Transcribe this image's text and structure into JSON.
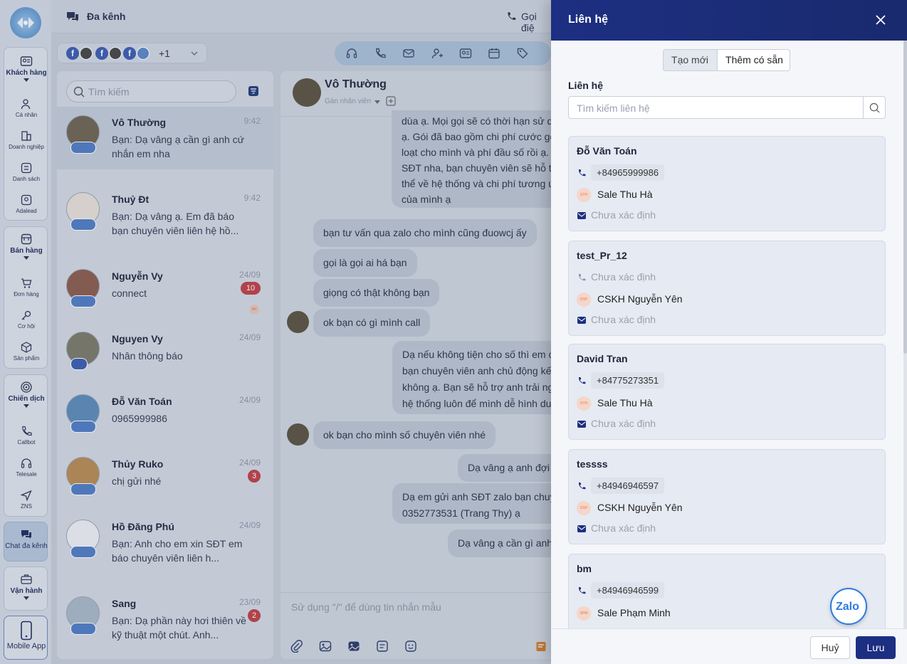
{
  "rail": {
    "khach_hang": "Khách hàng",
    "ca_nhan": "Cá nhân",
    "doanh_nghiep": "Doanh nghiệp",
    "danh_sach": "Danh sách",
    "adalead": "Adalead",
    "ban_hang": "Bán hàng",
    "don_hang": "Đơn hàng",
    "co_hoi": "Cơ hội",
    "san_pham": "Sản phẩm",
    "chien_dich": "Chiến dịch",
    "callbot": "Callbot",
    "telesale": "Telesale",
    "zns": "ZNS",
    "chat_da_kenh": "Chat đa kênh",
    "van_hanh": "Vận hành",
    "mobile_app": "Mobile App"
  },
  "header": {
    "title": "Đa kênh",
    "call": "Gọi điệ"
  },
  "channels": {
    "more": "+1"
  },
  "list": {
    "search_placeholder": "Tìm kiếm",
    "items": [
      {
        "name": "Vô Thường",
        "time": "9:42",
        "msg": "Bạn: Dạ vâng ạ cần gì anh cứ nhắn em nha"
      },
      {
        "name": "Thuỷ Đt",
        "time": "9:42",
        "msg": "Bạn: Dạ vâng ạ. Em đã báo bạn chuyên viên liên hệ hồ..."
      },
      {
        "name": "Nguyễn Vy",
        "time": "24/09",
        "msg": "connect",
        "count": "10",
        "tag": "NV"
      },
      {
        "name": "Nguyen Vy",
        "time": "24/09",
        "msg": "Nhân thông báo"
      },
      {
        "name": "Đỗ Văn Toán",
        "time": "24/09",
        "msg": "0965999986"
      },
      {
        "name": "Thủy Ruko",
        "time": "24/09",
        "msg": "chị gửi nhé",
        "count": "3"
      },
      {
        "name": "Hồ Đăng Phú",
        "time": "24/09",
        "msg": "Bạn: Anh cho em xin SĐT em báo chuyên viên liên h..."
      },
      {
        "name": "Sang",
        "time": "23/09",
        "msg": "Bạn: Dạ phần này hơi thiên về kỹ thuật một chút. Anh...",
        "count": "2"
      }
    ]
  },
  "chat": {
    "name": "Vô Thường",
    "assign": "Gán nhân viên",
    "messages": [
      {
        "text": "dùa ạ. Mọi gọi sẽ có thời hạn sử d\nạ. Gói đã bao gồm chi phí cước gọ\nloạt cho mình và phí đầu số rồi ạ.\nSĐT nha, bạn chuyên viên sẽ hỗ tr\nthể về hệ thống và chi phí tương ứ\ncủa mình ạ"
      },
      {
        "text": "bạn tư vấn qua zalo cho mình cũng đuowcj ấy"
      },
      {
        "text": "gọi là gọi ai há bạn"
      },
      {
        "text": "giọng có thật không bạn"
      },
      {
        "text": "ok bạn có gì mình call"
      },
      {
        "text": "Dạ nếu không tiện cho số thì em c\nbạn chuyên viên anh chủ động kết\nkhông ạ. Bạn sẽ hỗ trợ anh trải ng\nhệ thống luôn để mình dễ hình du"
      },
      {
        "text": "ok bạn cho mình số chuyên viên nhé"
      },
      {
        "text": "Dạ vâng ạ anh đợi e"
      },
      {
        "text": "Dạ em gửi anh SĐT zalo bạn chuy\n0352773531 (Trang Thy) ạ"
      },
      {
        "text": "Dạ vâng ạ cần gì anh"
      }
    ],
    "input_placeholder": "Sử dụng \"/\" để dùng tin nhắn mẫu"
  },
  "drawer": {
    "title": "Liên hệ",
    "tab_new": "Tạo mới",
    "tab_existing": "Thêm có sẵn",
    "field_label": "Liên hệ",
    "search_placeholder": "Tìm kiếm liên hệ",
    "cards": [
      {
        "name": "Đỗ Văn Toán",
        "phone": "+84965999986",
        "owner_initials": "STH",
        "owner": "Sale Thu Hà",
        "email": "Chưa xác định"
      },
      {
        "name": "test_Pr_12",
        "phone": "Chưa xác định",
        "owner_initials": "CNY",
        "owner": "CSKH Nguyễn Yên",
        "email": "Chưa xác định"
      },
      {
        "name": "David Tran",
        "phone": "+84775273351",
        "owner_initials": "STH",
        "owner": "Sale Thu Hà",
        "email": "Chưa xác định"
      },
      {
        "name": "tessss",
        "phone": "+84946946597",
        "owner_initials": "CNY",
        "owner": "CSKH Nguyễn Yên",
        "email": "Chưa xác định"
      },
      {
        "name": "bm",
        "phone": "+84946946599",
        "owner_initials": "SPM",
        "owner": "Sale Phạm Minh"
      }
    ],
    "cancel": "Huỷ",
    "save": "Lưu",
    "zalo": "Zalo"
  }
}
